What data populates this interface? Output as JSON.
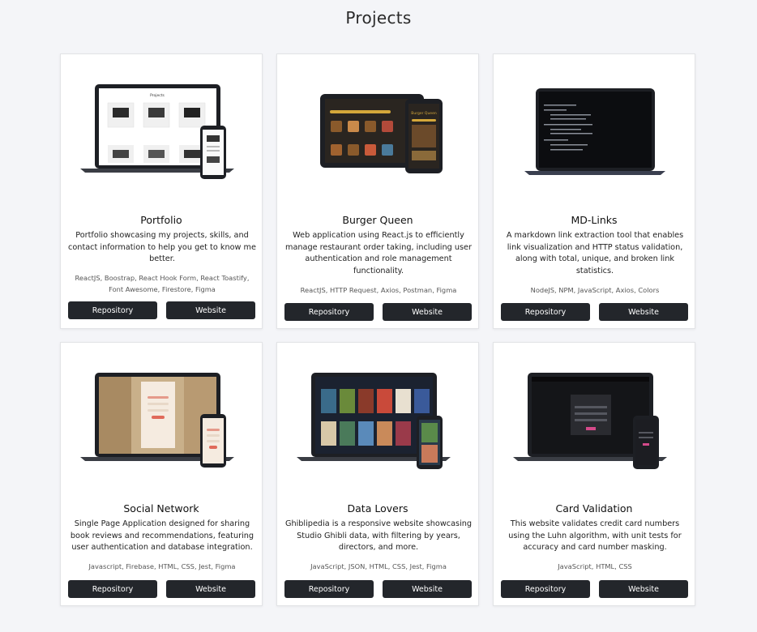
{
  "page": {
    "title": "Projects"
  },
  "projects": [
    {
      "title": "Portfolio",
      "description": "Portfolio showcasing my projects, skills, and contact information to help you get to know me better.",
      "technologies": "ReactJS, Boostrap, React Hook Form, React Toastify, Font Awesome, Firestore, Figma",
      "repository_label": "Repository",
      "website_label": "Website",
      "preview": {
        "name": "laptop-phone-mockup",
        "screen_text": "Projects"
      }
    },
    {
      "title": "Burger Queen",
      "description": "Web application using React.js to efficiently manage restaurant order taking, including user authentication and role management functionality.",
      "technologies": "ReactJS, HTTP Request, Axios, Postman, Figma",
      "repository_label": "Repository",
      "website_label": "Website",
      "preview": {
        "name": "tablet-phone-mockup",
        "screen_text": "Burger Queen"
      }
    },
    {
      "title": "MD-Links",
      "description": "A markdown link extraction tool that enables link visualization and HTTP status validation, along with total, unique, and broken link statistics.",
      "technologies": "NodeJS, NPM, JavaScript, Axios, Colors",
      "repository_label": "Repository",
      "website_label": "Website",
      "preview": {
        "name": "laptop-terminal-mockup"
      }
    },
    {
      "title": "Social Network",
      "description": "Single Page Application designed for sharing book reviews and recommendations, featuring user authentication and database integration.",
      "technologies": "Javascript, Firebase, HTML, CSS, Jest, Figma",
      "repository_label": "Repository",
      "website_label": "Website",
      "preview": {
        "name": "laptop-phone-mockup"
      }
    },
    {
      "title": "Data Lovers",
      "description": "Ghiblipedia is a responsive website showcasing Studio Ghibli data, with filtering by years, directors, and more.",
      "technologies": "JavaScript, JSON, HTML, CSS, Jest, Figma",
      "repository_label": "Repository",
      "website_label": "Website",
      "preview": {
        "name": "laptop-phone-mockup"
      }
    },
    {
      "title": "Card Validation",
      "description": "This website validates credit card numbers using the Luhn algorithm, with unit tests for accuracy and card number masking.",
      "technologies": "JavaScript, HTML, CSS",
      "repository_label": "Repository",
      "website_label": "Website",
      "preview": {
        "name": "laptop-phone-mockup"
      }
    }
  ],
  "colors": {
    "background": "#f4f5f8",
    "card": "#ffffff",
    "button": "#23262b",
    "button_text": "#ffffff",
    "device_frame": "#1d1f24"
  }
}
